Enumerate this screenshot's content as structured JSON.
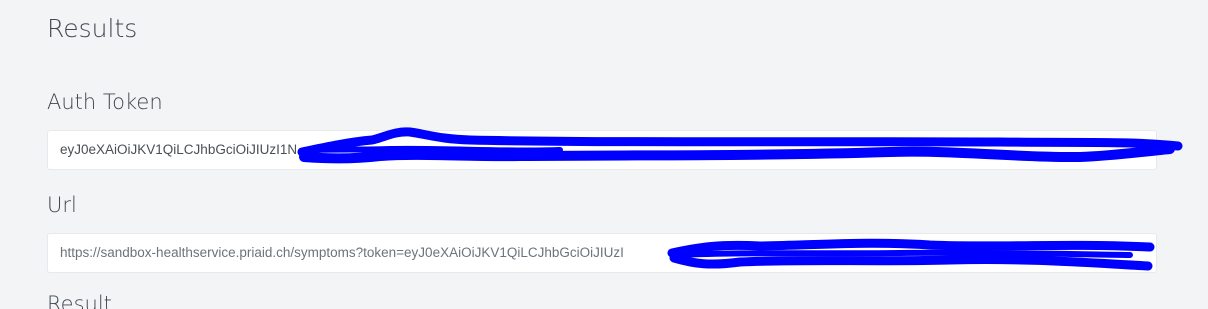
{
  "section_title": "Results",
  "auth_token": {
    "label": "Auth Token",
    "value": "eyJ0eXAiOiJKV1QiLCJhbGciOiJIUzI1N"
  },
  "url": {
    "label": "Url",
    "value": "https://sandbox-healthservice.priaid.ch/symptoms?token=eyJ0eXAiOiJKV1QiLCJhbGciOiJIUzI"
  },
  "result": {
    "label": "Result"
  },
  "redaction_color": "#0000ff"
}
